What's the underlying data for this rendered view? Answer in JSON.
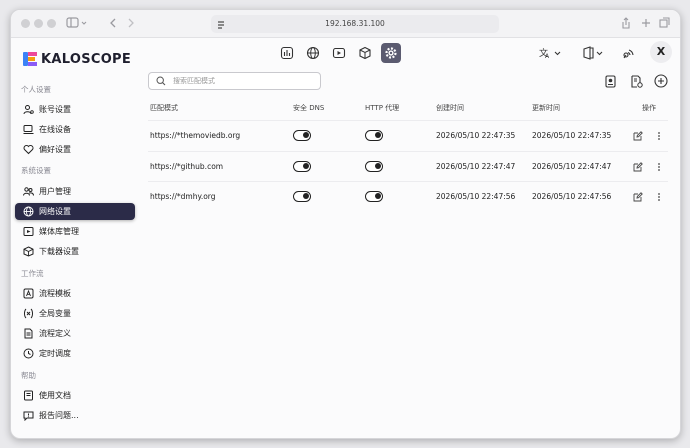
{
  "browser": {
    "url": "192.168.31.100"
  },
  "app": {
    "logo_text": "KALOSCOPE",
    "avatar_letter": "X",
    "nav_icons": [
      "dashboard-icon",
      "globe-icon",
      "play-icon",
      "cube-icon",
      "settings-icon"
    ],
    "active_nav": "settings-icon"
  },
  "sidebar": {
    "sections": [
      {
        "label": "个人设置"
      },
      {
        "label": "系统设置"
      },
      {
        "label": "工作流"
      },
      {
        "label": "帮助"
      }
    ],
    "items": [
      {
        "label": "账号设置",
        "icon": "user-settings-icon"
      },
      {
        "label": "在线设备",
        "icon": "devices-icon"
      },
      {
        "label": "偏好设置",
        "icon": "heart-icon"
      },
      {
        "label": "用户管理",
        "icon": "users-icon"
      },
      {
        "label": "网络设置",
        "icon": "network-icon",
        "active": true
      },
      {
        "label": "媒体库管理",
        "icon": "library-icon"
      },
      {
        "label": "下载器设置",
        "icon": "download-box-icon"
      },
      {
        "label": "流程模板",
        "icon": "template-icon"
      },
      {
        "label": "全局变量",
        "icon": "variable-icon"
      },
      {
        "label": "流程定义",
        "icon": "document-icon"
      },
      {
        "label": "定时调度",
        "icon": "clock-icon"
      },
      {
        "label": "使用文档",
        "icon": "book-icon"
      },
      {
        "label": "报告问题...",
        "icon": "report-icon"
      }
    ]
  },
  "search": {
    "placeholder": "搜索匹配模式"
  },
  "table": {
    "headers": [
      "匹配模式",
      "安全 DNS",
      "HTTP 代理",
      "创建时间",
      "更新时间",
      "操作"
    ],
    "rows": [
      {
        "pattern": "https://*themoviedb.org",
        "secure_dns": true,
        "http_proxy": true,
        "created": "2026/05/10 22:47:35",
        "updated": "2026/05/10 22:47:35"
      },
      {
        "pattern": "https://*github.com",
        "secure_dns": true,
        "http_proxy": true,
        "created": "2026/05/10 22:47:47",
        "updated": "2026/05/10 22:47:47"
      },
      {
        "pattern": "https://*dmhy.org",
        "secure_dns": true,
        "http_proxy": true,
        "created": "2026/05/10 22:47:56",
        "updated": "2026/05/10 22:47:56"
      }
    ]
  }
}
